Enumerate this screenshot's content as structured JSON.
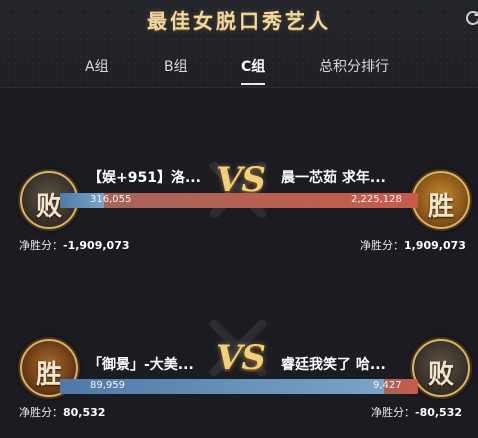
{
  "header": {
    "title": "最佳女脱口秀艺人"
  },
  "tabs": [
    {
      "label": "A组"
    },
    {
      "label": "B组"
    },
    {
      "label": "C组",
      "active": true
    },
    {
      "label": "总积分排行"
    }
  ],
  "matches": [
    {
      "vs": "VS",
      "left": {
        "result": "败",
        "name": "【娱+951】洛...",
        "votes": "316,055",
        "net_label": "净胜分：",
        "net": "-1,909,073"
      },
      "right": {
        "result": "胜",
        "name": "晨一芯茹 求年...",
        "votes": "2,225,128",
        "net_label": "净胜分：",
        "net": "1,909,073"
      },
      "left_share": 0.124
    },
    {
      "vs": "VS",
      "left": {
        "result": "胜",
        "name": "「御景」-大美...",
        "votes": "89,959",
        "net_label": "净胜分：",
        "net": "80,532"
      },
      "right": {
        "result": "败",
        "name": "睿廷我笑了 哈...",
        "votes": "9,427",
        "net_label": "净胜分：",
        "net": "-80,532"
      },
      "left_share": 0.905
    }
  ],
  "colors": {
    "accent": "#f2cf7a",
    "left_bar": "#6f97bf",
    "right_bar": "#c25d50"
  }
}
